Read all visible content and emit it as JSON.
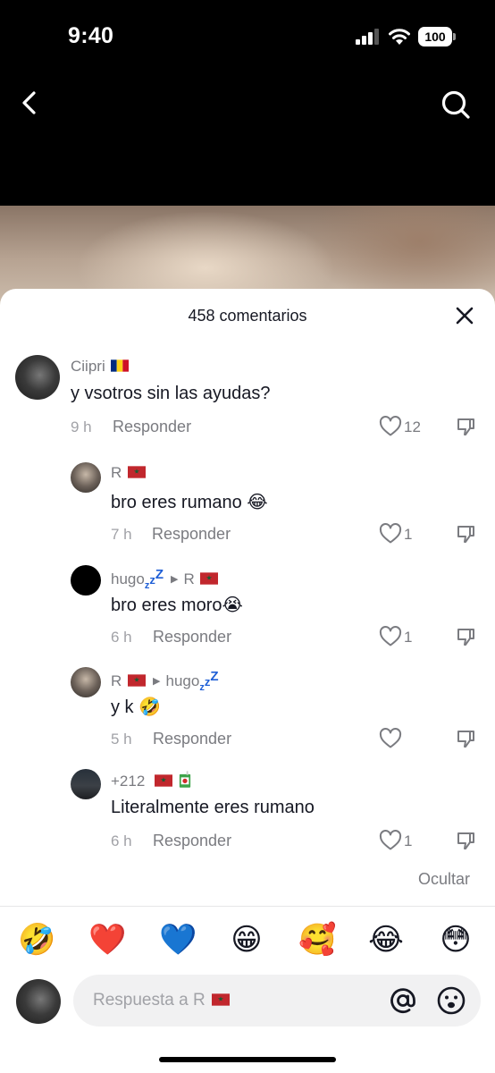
{
  "status_bar": {
    "time": "9:40",
    "battery": "100"
  },
  "nav": {
    "back_icon": "chevron-left-icon",
    "search_icon": "search-icon"
  },
  "sheet": {
    "title": "458 comentarios",
    "close_icon": "close-icon"
  },
  "comments": [
    {
      "user": "Ciipri",
      "flag": "romania",
      "text": "y vsotros sin las ayudas?",
      "time": "9 h",
      "reply": "Responder",
      "likes": "12"
    },
    {
      "user": "R",
      "flag": "morocco",
      "text": "bro eres rumano 😂",
      "time": "7 h",
      "reply": "Responder",
      "likes": "1"
    },
    {
      "user": "hugo",
      "reply_to": "R",
      "text": "bro eres moro😭",
      "time": "6 h",
      "reply": "Responder",
      "likes": "1"
    },
    {
      "user": "R",
      "reply_to": "hugo",
      "text": "y k 🤣",
      "time": "5 h",
      "reply": "Responder",
      "likes": ""
    },
    {
      "user": "+212",
      "flag": "morocco",
      "text": "Literalmente eres rumano",
      "time": "6 h",
      "reply": "Responder",
      "likes": "1"
    }
  ],
  "hide_label": "Ocultar",
  "emoji_bar": [
    "🤣",
    "❤️",
    "💙",
    "😁",
    "🥰",
    "😂",
    "😳"
  ],
  "composer": {
    "placeholder": "Respuesta a R",
    "at_icon": "at-icon",
    "emoji_icon": "smiley-icon"
  },
  "colors": {
    "text": "#161823",
    "muted": "#7a7b80",
    "light": "#a1a2a7"
  }
}
